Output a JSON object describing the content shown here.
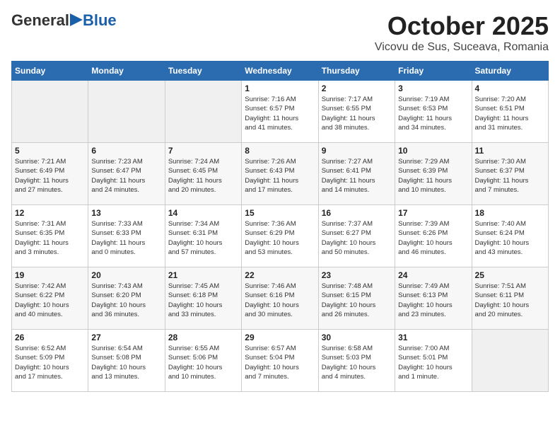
{
  "header": {
    "logo_general": "General",
    "logo_blue": "Blue",
    "title": "October 2025",
    "location": "Vicovu de Sus, Suceava, Romania"
  },
  "calendar": {
    "days_of_week": [
      "Sunday",
      "Monday",
      "Tuesday",
      "Wednesday",
      "Thursday",
      "Friday",
      "Saturday"
    ],
    "weeks": [
      [
        {
          "day": "",
          "info": ""
        },
        {
          "day": "",
          "info": ""
        },
        {
          "day": "",
          "info": ""
        },
        {
          "day": "1",
          "info": "Sunrise: 7:16 AM\nSunset: 6:57 PM\nDaylight: 11 hours\nand 41 minutes."
        },
        {
          "day": "2",
          "info": "Sunrise: 7:17 AM\nSunset: 6:55 PM\nDaylight: 11 hours\nand 38 minutes."
        },
        {
          "day": "3",
          "info": "Sunrise: 7:19 AM\nSunset: 6:53 PM\nDaylight: 11 hours\nand 34 minutes."
        },
        {
          "day": "4",
          "info": "Sunrise: 7:20 AM\nSunset: 6:51 PM\nDaylight: 11 hours\nand 31 minutes."
        }
      ],
      [
        {
          "day": "5",
          "info": "Sunrise: 7:21 AM\nSunset: 6:49 PM\nDaylight: 11 hours\nand 27 minutes."
        },
        {
          "day": "6",
          "info": "Sunrise: 7:23 AM\nSunset: 6:47 PM\nDaylight: 11 hours\nand 24 minutes."
        },
        {
          "day": "7",
          "info": "Sunrise: 7:24 AM\nSunset: 6:45 PM\nDaylight: 11 hours\nand 20 minutes."
        },
        {
          "day": "8",
          "info": "Sunrise: 7:26 AM\nSunset: 6:43 PM\nDaylight: 11 hours\nand 17 minutes."
        },
        {
          "day": "9",
          "info": "Sunrise: 7:27 AM\nSunset: 6:41 PM\nDaylight: 11 hours\nand 14 minutes."
        },
        {
          "day": "10",
          "info": "Sunrise: 7:29 AM\nSunset: 6:39 PM\nDaylight: 11 hours\nand 10 minutes."
        },
        {
          "day": "11",
          "info": "Sunrise: 7:30 AM\nSunset: 6:37 PM\nDaylight: 11 hours\nand 7 minutes."
        }
      ],
      [
        {
          "day": "12",
          "info": "Sunrise: 7:31 AM\nSunset: 6:35 PM\nDaylight: 11 hours\nand 3 minutes."
        },
        {
          "day": "13",
          "info": "Sunrise: 7:33 AM\nSunset: 6:33 PM\nDaylight: 11 hours\nand 0 minutes."
        },
        {
          "day": "14",
          "info": "Sunrise: 7:34 AM\nSunset: 6:31 PM\nDaylight: 10 hours\nand 57 minutes."
        },
        {
          "day": "15",
          "info": "Sunrise: 7:36 AM\nSunset: 6:29 PM\nDaylight: 10 hours\nand 53 minutes."
        },
        {
          "day": "16",
          "info": "Sunrise: 7:37 AM\nSunset: 6:27 PM\nDaylight: 10 hours\nand 50 minutes."
        },
        {
          "day": "17",
          "info": "Sunrise: 7:39 AM\nSunset: 6:26 PM\nDaylight: 10 hours\nand 46 minutes."
        },
        {
          "day": "18",
          "info": "Sunrise: 7:40 AM\nSunset: 6:24 PM\nDaylight: 10 hours\nand 43 minutes."
        }
      ],
      [
        {
          "day": "19",
          "info": "Sunrise: 7:42 AM\nSunset: 6:22 PM\nDaylight: 10 hours\nand 40 minutes."
        },
        {
          "day": "20",
          "info": "Sunrise: 7:43 AM\nSunset: 6:20 PM\nDaylight: 10 hours\nand 36 minutes."
        },
        {
          "day": "21",
          "info": "Sunrise: 7:45 AM\nSunset: 6:18 PM\nDaylight: 10 hours\nand 33 minutes."
        },
        {
          "day": "22",
          "info": "Sunrise: 7:46 AM\nSunset: 6:16 PM\nDaylight: 10 hours\nand 30 minutes."
        },
        {
          "day": "23",
          "info": "Sunrise: 7:48 AM\nSunset: 6:15 PM\nDaylight: 10 hours\nand 26 minutes."
        },
        {
          "day": "24",
          "info": "Sunrise: 7:49 AM\nSunset: 6:13 PM\nDaylight: 10 hours\nand 23 minutes."
        },
        {
          "day": "25",
          "info": "Sunrise: 7:51 AM\nSunset: 6:11 PM\nDaylight: 10 hours\nand 20 minutes."
        }
      ],
      [
        {
          "day": "26",
          "info": "Sunrise: 6:52 AM\nSunset: 5:09 PM\nDaylight: 10 hours\nand 17 minutes."
        },
        {
          "day": "27",
          "info": "Sunrise: 6:54 AM\nSunset: 5:08 PM\nDaylight: 10 hours\nand 13 minutes."
        },
        {
          "day": "28",
          "info": "Sunrise: 6:55 AM\nSunset: 5:06 PM\nDaylight: 10 hours\nand 10 minutes."
        },
        {
          "day": "29",
          "info": "Sunrise: 6:57 AM\nSunset: 5:04 PM\nDaylight: 10 hours\nand 7 minutes."
        },
        {
          "day": "30",
          "info": "Sunrise: 6:58 AM\nSunset: 5:03 PM\nDaylight: 10 hours\nand 4 minutes."
        },
        {
          "day": "31",
          "info": "Sunrise: 7:00 AM\nSunset: 5:01 PM\nDaylight: 10 hours\nand 1 minute."
        },
        {
          "day": "",
          "info": ""
        }
      ]
    ]
  }
}
